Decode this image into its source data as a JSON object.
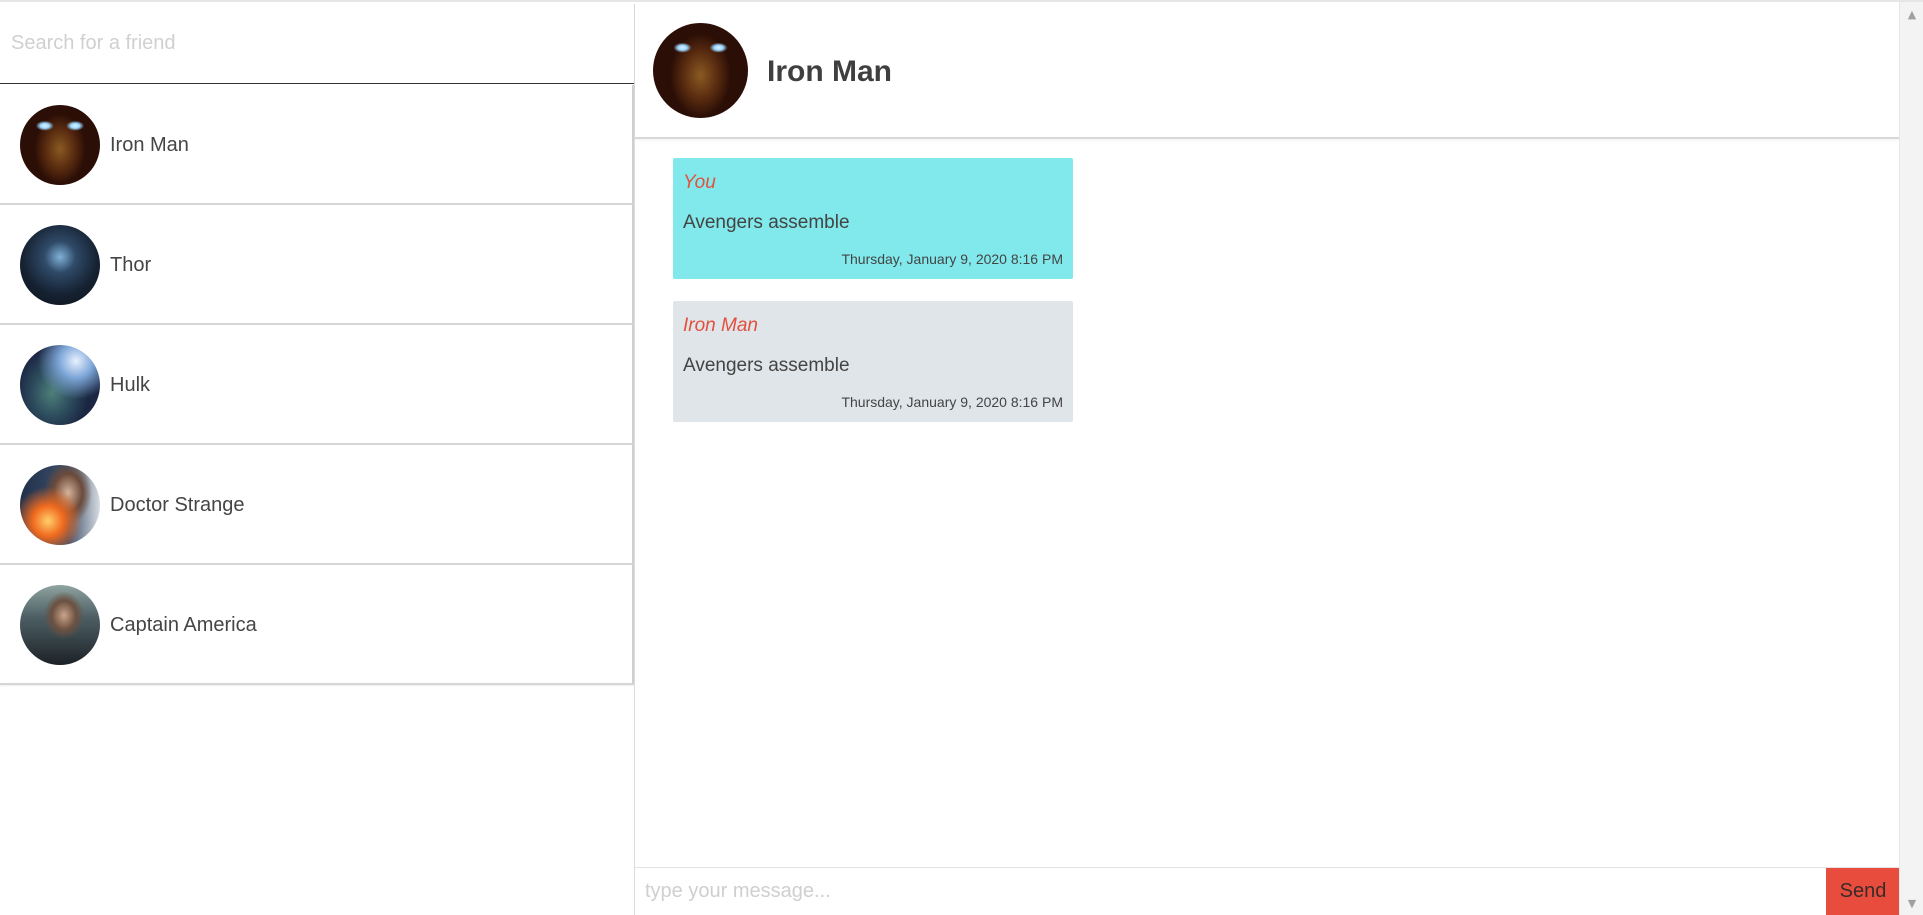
{
  "search": {
    "placeholder": "Search for a friend"
  },
  "friends": [
    {
      "name": "Iron Man",
      "avatar_icon": "iron-man-avatar"
    },
    {
      "name": "Thor",
      "avatar_icon": "thor-avatar"
    },
    {
      "name": "Hulk",
      "avatar_icon": "hulk-avatar"
    },
    {
      "name": "Doctor Strange",
      "avatar_icon": "doctor-strange-avatar"
    },
    {
      "name": "Captain America",
      "avatar_icon": "captain-america-avatar"
    }
  ],
  "chat": {
    "title": "Iron Man",
    "messages": [
      {
        "from": "You",
        "text": "Avengers assemble",
        "time": "Thursday, January 9, 2020 8:16 PM",
        "bg": "#81e9eb"
      },
      {
        "from": "Iron Man",
        "text": "Avengers assemble",
        "time": "Thursday, January 9, 2020 8:16 PM",
        "bg": "#e0e5e9"
      }
    ]
  },
  "composer": {
    "placeholder": "type your message...",
    "send_label": "Send"
  },
  "colors": {
    "accent": "#e74c3c",
    "sender": "#e2513e",
    "own_bubble": "#81e9eb",
    "other_bubble": "#e0e5e9"
  }
}
